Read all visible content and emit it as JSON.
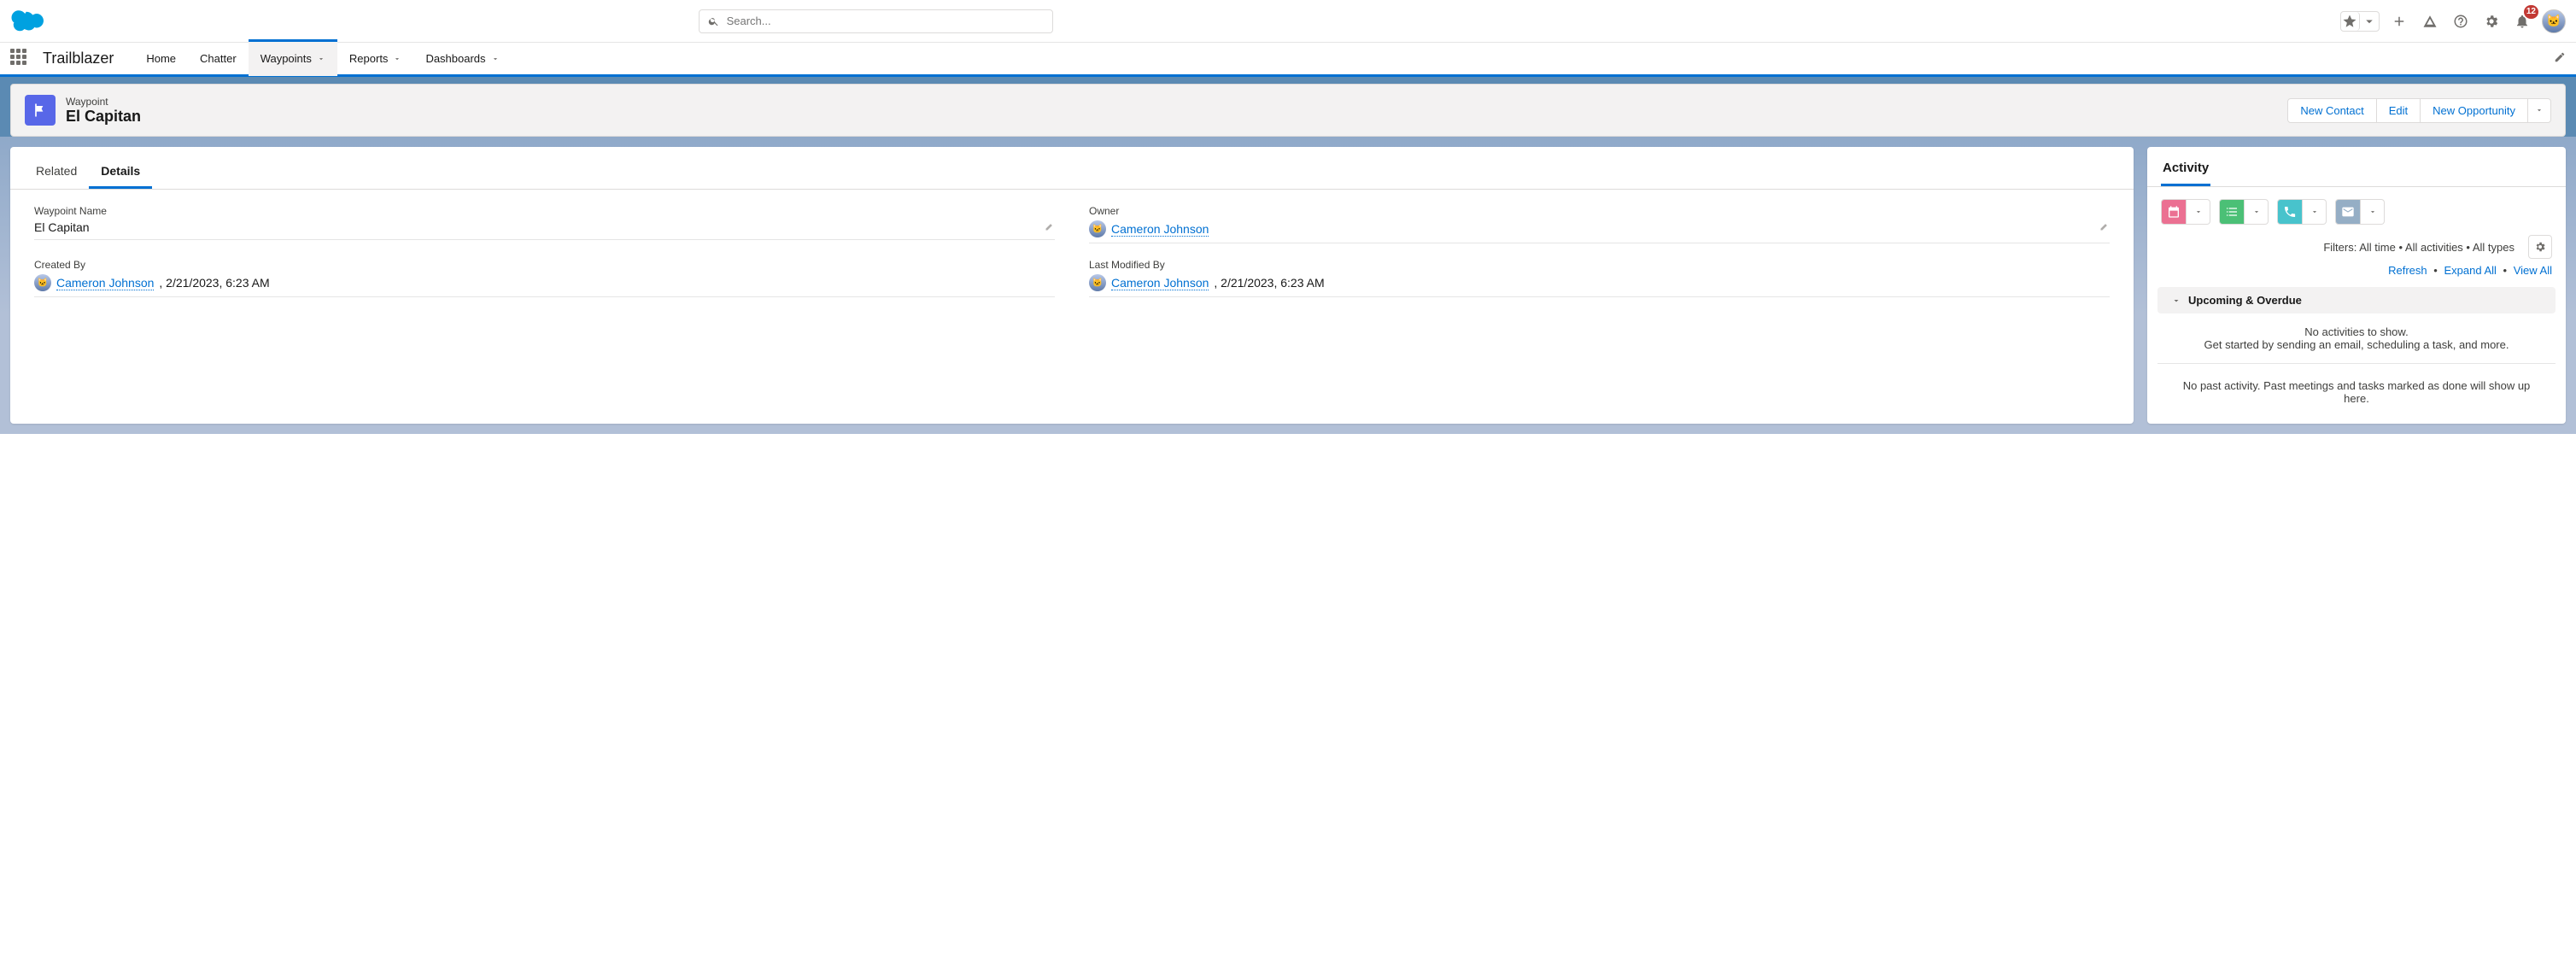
{
  "search": {
    "placeholder": "Search..."
  },
  "notifications": {
    "count": "12"
  },
  "app": {
    "name": "Trailblazer"
  },
  "nav": {
    "items": [
      {
        "label": "Home",
        "hasMenu": false
      },
      {
        "label": "Chatter",
        "hasMenu": false
      },
      {
        "label": "Waypoints",
        "hasMenu": true,
        "active": true
      },
      {
        "label": "Reports",
        "hasMenu": true
      },
      {
        "label": "Dashboards",
        "hasMenu": true
      }
    ]
  },
  "record": {
    "objectType": "Waypoint",
    "title": "El Capitan",
    "actions": [
      {
        "label": "New Contact"
      },
      {
        "label": "Edit"
      },
      {
        "label": "New Opportunity"
      }
    ]
  },
  "tabs": {
    "related": "Related",
    "details": "Details"
  },
  "details": {
    "fields": {
      "waypointName": {
        "label": "Waypoint Name",
        "value": "El Capitan"
      },
      "owner": {
        "label": "Owner",
        "user": "Cameron Johnson"
      },
      "createdBy": {
        "label": "Created By",
        "user": "Cameron Johnson",
        "timestamp": ", 2/21/2023, 6:23 AM"
      },
      "lastModifiedBy": {
        "label": "Last Modified By",
        "user": "Cameron Johnson",
        "timestamp": ", 2/21/2023, 6:23 AM"
      }
    }
  },
  "activity": {
    "tabLabel": "Activity",
    "filterText": "Filters: All time • All activities • All types",
    "links": {
      "refresh": "Refresh",
      "expand": "Expand All",
      "viewAll": "View All"
    },
    "sectionTitle": "Upcoming & Overdue",
    "emptyLine1": "No activities to show.",
    "emptyLine2": "Get started by sending an email, scheduling a task, and more.",
    "pastEmpty": "No past activity. Past meetings and tasks marked as done will show up here."
  }
}
